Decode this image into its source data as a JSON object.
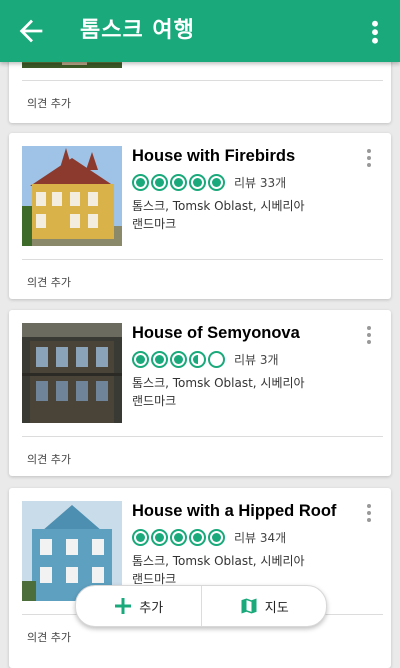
{
  "header": {
    "title": "톰스크 여행",
    "back_icon": "arrow-left-icon",
    "menu_icon": "more-vert-icon"
  },
  "colors": {
    "accent": "#1aa97b"
  },
  "first_card": {
    "opinion": "의견 추가"
  },
  "cards": [
    {
      "name": "House with Firebirds",
      "rating": 5,
      "reviews": "리뷰 33개",
      "location": "톰스크, Tomsk Oblast, 시베리아",
      "category": "랜드마크",
      "opinion": "의견 추가"
    },
    {
      "name": "House of Semyonova",
      "rating": 3.5,
      "reviews": "리뷰 3개",
      "location": "톰스크, Tomsk Oblast, 시베리아",
      "category": "랜드마크",
      "opinion": "의견 추가"
    },
    {
      "name": "House with a Hipped Roof",
      "rating": 5,
      "reviews": "리뷰 34개",
      "location": "톰스크, Tomsk Oblast, 시베리아",
      "category": "랜드마크",
      "opinion": "의견 추가"
    }
  ],
  "actions": {
    "add_label": "추가",
    "map_label": "지도"
  }
}
